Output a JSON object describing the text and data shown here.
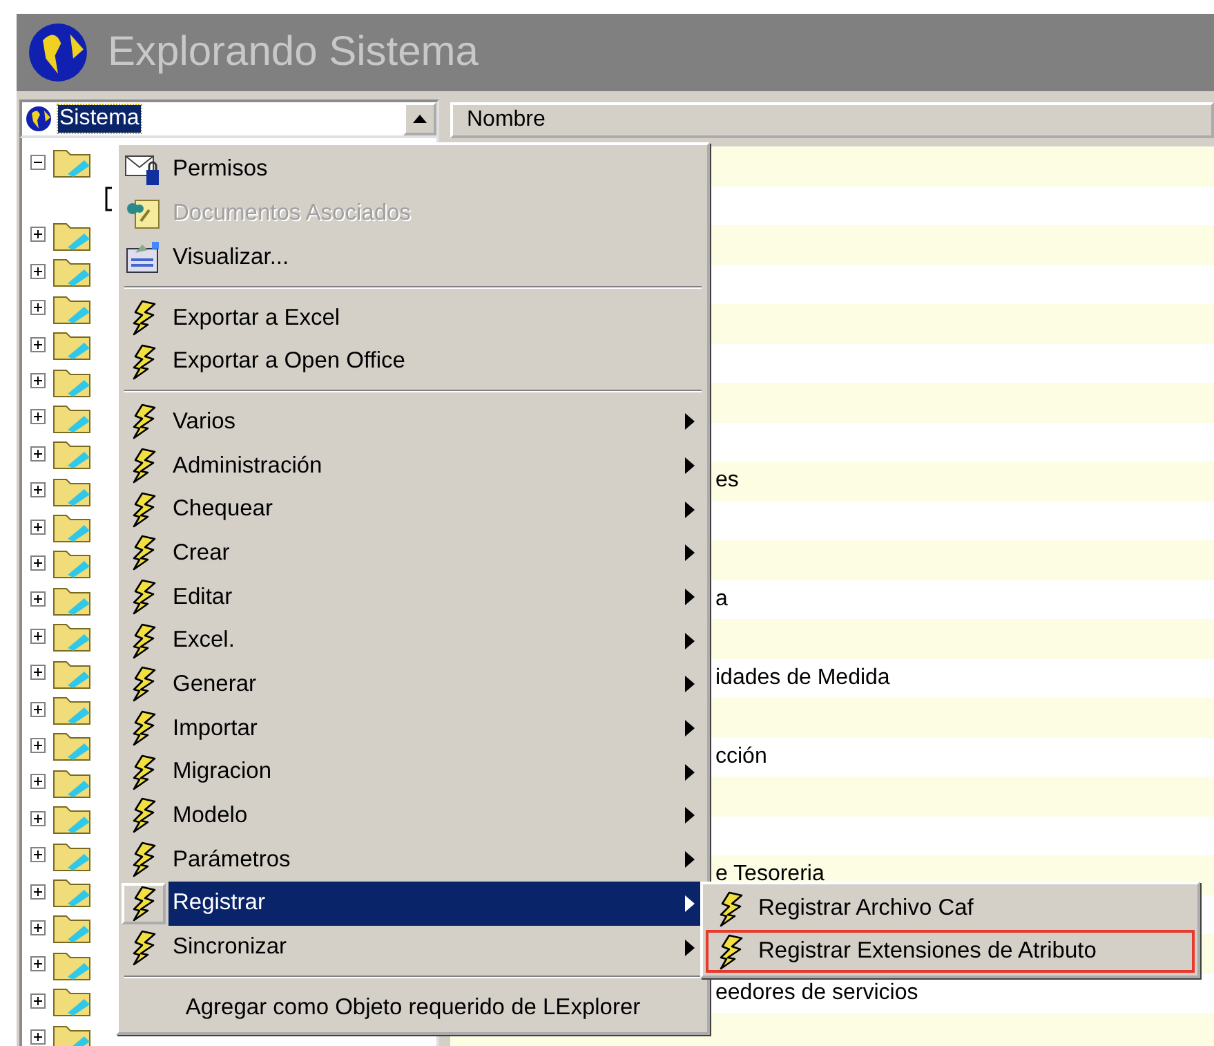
{
  "window": {
    "title": "Explorando Sistema"
  },
  "tree": {
    "root": {
      "label": "Sistema",
      "selected": true
    },
    "nodes": [
      {
        "expanded": true,
        "children": [
          {
            "kind": "leaf"
          }
        ]
      },
      {
        "expanded": false
      },
      {
        "expanded": false
      },
      {
        "expanded": false
      },
      {
        "expanded": false
      },
      {
        "expanded": false
      },
      {
        "expanded": false
      },
      {
        "expanded": false
      },
      {
        "expanded": false
      },
      {
        "expanded": false
      },
      {
        "expanded": false
      },
      {
        "expanded": false
      },
      {
        "expanded": false
      },
      {
        "expanded": false
      },
      {
        "expanded": false
      },
      {
        "expanded": false
      },
      {
        "expanded": false
      },
      {
        "expanded": false
      },
      {
        "expanded": false
      },
      {
        "expanded": false
      },
      {
        "expanded": false
      },
      {
        "expanded": false
      },
      {
        "expanded": false
      },
      {
        "expanded": false
      }
    ]
  },
  "list": {
    "columns": [
      "Nombre"
    ],
    "rows": [
      {},
      {},
      {},
      {},
      {},
      {},
      {},
      {},
      {
        "text": "es"
      },
      {},
      {},
      {
        "text": "a"
      },
      {},
      {
        "text": "idades de Medida"
      },
      {},
      {
        "text": "cción"
      },
      {},
      {},
      {
        "text": "e Tesoreria"
      },
      {},
      {},
      {
        "text": "eedores de servicios"
      },
      {}
    ]
  },
  "context_menu": {
    "sections": [
      {
        "items": [
          {
            "kind": "mail",
            "label": "Permisos",
            "disabled": false,
            "submenu": false,
            "selected": false
          },
          {
            "kind": "attach",
            "label": "Documentos Asociados",
            "disabled": true,
            "submenu": false,
            "selected": false
          },
          {
            "kind": "view",
            "label": "Visualizar...",
            "disabled": false,
            "submenu": false,
            "selected": false
          }
        ]
      },
      {
        "items": [
          {
            "kind": "action",
            "label": "Exportar a Excel",
            "disabled": false,
            "submenu": false,
            "selected": false
          },
          {
            "kind": "action",
            "label": "Exportar a Open Office",
            "disabled": false,
            "submenu": false,
            "selected": false
          }
        ]
      },
      {
        "items": [
          {
            "kind": "action",
            "label": "Varios",
            "disabled": false,
            "submenu": true,
            "selected": false
          },
          {
            "kind": "action",
            "label": "Administración",
            "disabled": false,
            "submenu": true,
            "selected": false
          },
          {
            "kind": "action",
            "label": "Chequear",
            "disabled": false,
            "submenu": true,
            "selected": false
          },
          {
            "kind": "action",
            "label": "Crear",
            "disabled": false,
            "submenu": true,
            "selected": false
          },
          {
            "kind": "action",
            "label": "Editar",
            "disabled": false,
            "submenu": true,
            "selected": false
          },
          {
            "kind": "action",
            "label": "Excel.",
            "disabled": false,
            "submenu": true,
            "selected": false
          },
          {
            "kind": "action",
            "label": "Generar",
            "disabled": false,
            "submenu": true,
            "selected": false
          },
          {
            "kind": "action",
            "label": "Importar",
            "disabled": false,
            "submenu": true,
            "selected": false
          },
          {
            "kind": "action",
            "label": "Migracion",
            "disabled": false,
            "submenu": true,
            "selected": false
          },
          {
            "kind": "action",
            "label": "Modelo",
            "disabled": false,
            "submenu": true,
            "selected": false
          },
          {
            "kind": "action",
            "label": "Parámetros",
            "disabled": false,
            "submenu": true,
            "selected": false
          },
          {
            "kind": "action",
            "label": "Registrar",
            "disabled": false,
            "submenu": true,
            "selected": true
          },
          {
            "kind": "action",
            "label": "Sincronizar",
            "disabled": false,
            "submenu": true,
            "selected": false
          }
        ]
      },
      {
        "items": [
          {
            "kind": "plain",
            "label": "Agregar como Objeto requerido de LExplorer",
            "disabled": false,
            "submenu": false,
            "selected": false
          }
        ]
      }
    ]
  },
  "submenu": {
    "items": [
      {
        "label": "Registrar Archivo Caf",
        "outlined": false
      },
      {
        "label": "Registrar Extensiones de Atributo",
        "outlined": true
      }
    ]
  }
}
